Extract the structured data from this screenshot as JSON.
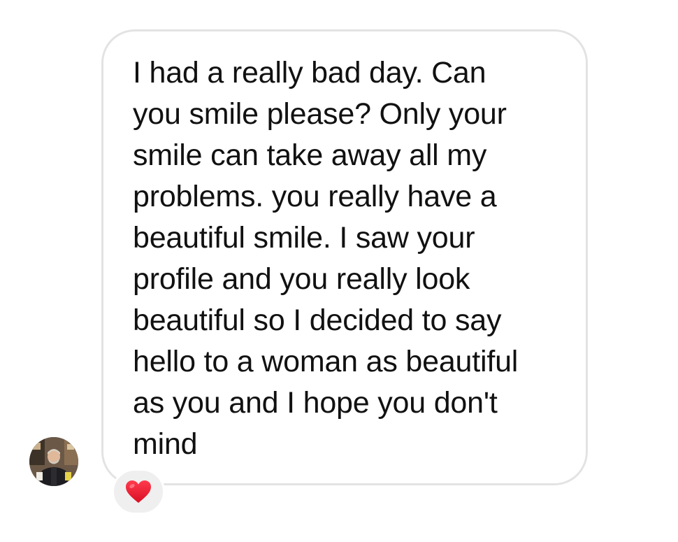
{
  "message": {
    "text": "I had a really bad day.  Can\nyou smile please?  Only your\nsmile can take away all my\nproblems.  you really have a\nbeautiful smile.  I saw your\nprofile and you really look\nbeautiful so I decided to say\nhello to a woman as beautiful\nas you and I hope you don't\nmind"
  },
  "sender": {
    "avatar_icon": "profile-photo"
  },
  "reaction": {
    "icon": "heart-icon",
    "color": "#e0142b"
  },
  "colors": {
    "bubble_border": "#e3e3e3",
    "reaction_bg": "#efefef",
    "text": "#111111"
  }
}
